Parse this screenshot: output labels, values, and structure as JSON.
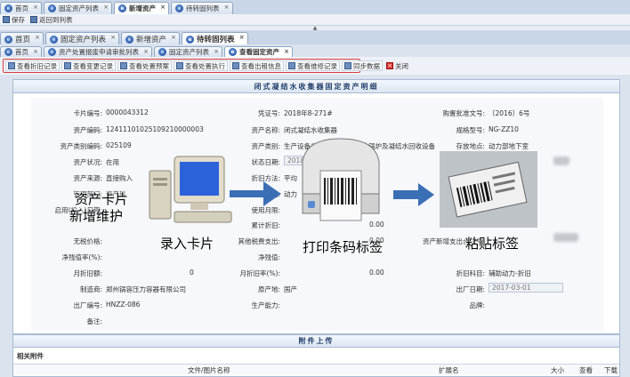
{
  "top_tabs": [
    {
      "label": "首页"
    },
    {
      "label": "固定资产列表"
    },
    {
      "label": "新增资产",
      "active": true
    },
    {
      "label": "待转固列表"
    }
  ],
  "toolbar1": {
    "save": "保存",
    "back": "返回到列表"
  },
  "second_tabs": [
    {
      "label": "首页"
    },
    {
      "label": "固定资产列表"
    },
    {
      "label": "新增资产"
    },
    {
      "label": "待转固列表",
      "active": true
    }
  ],
  "third_tabs": [
    {
      "label": "首页"
    },
    {
      "label": "资产处置报废申请审批列表"
    },
    {
      "label": "固定资产列表"
    },
    {
      "label": "查看固定资产",
      "active": true
    }
  ],
  "actions": [
    {
      "label": "查看折旧记录"
    },
    {
      "label": "查看变更记录"
    },
    {
      "label": "查看处置预案"
    },
    {
      "label": "查看处置执行"
    },
    {
      "label": "查看出租信息"
    },
    {
      "label": "查看维修记录"
    },
    {
      "label": "同步数据"
    },
    {
      "label": "关闭"
    }
  ],
  "panel_title": "闭式凝结水收集器固定资产明细",
  "fields": {
    "card_no_label": "卡片编号:",
    "card_no": "0000043312",
    "voucher_label": "凭证号:",
    "voucher": "2018年8-271#",
    "approval_label": "购置批准文号:",
    "approval": "〔2016〕6号",
    "asset_code_label": "资产编码:",
    "asset_code": "12411101025109210000003",
    "asset_name_label": "资产名称:",
    "asset_name": "闭式凝结水收集器",
    "model_label": "规格型号:",
    "model": "NG-ZZ10",
    "category_label": "资产类别编码:",
    "category": "025109",
    "category_name_label": "资产类别:",
    "category_name": "生产设备/锅炉及原动机/其他锅炉及凝结水回收设备",
    "location_label": "存放地点:",
    "location": "动力部地下室",
    "status_label": "资产状况:",
    "status": "在用",
    "status_date_label": "状态日期:",
    "status_date": "2018-08-3",
    "source_label": "资产来源:",
    "source": "直接购入",
    "depr_method_label": "折旧方法:",
    "depr_method": "平均",
    "mgmt_label": "管理部门:",
    "mgmt": "资产科",
    "use_dept_label": "使用部门:",
    "use_dept": "动力",
    "start_label": "启用(投入)日期:",
    "user_label": "使用月限:",
    "accum_label": "累计折旧:",
    "accum": "0.00",
    "intangible_label": "无税价格:",
    "other_tax_label": "其他税费支出:",
    "other_tax": "0.00",
    "new_contract_label": "资产新增支出合同号:",
    "net_rate_label": "净残值率(%):",
    "net_value_label": "净残值:",
    "monthly_label": "月折旧额:",
    "monthly": "0",
    "monthly_rate_label": "月折旧率(%):",
    "monthly_rate": "0.00",
    "depr_cat_label": "折旧科目:",
    "depr_cat": "辅助动力-折旧",
    "maker_label": "制造商:",
    "maker": "郑州锅容压力容器有限公司",
    "origin_label": "原产地:",
    "origin": "国产",
    "factory_date_label": "出厂日期:",
    "factory_date": "2017-03-01",
    "serial_label": "出厂编号:",
    "serial": "HNZZ-086",
    "capacity_label": "生产能力:",
    "brand_label": "品牌:",
    "note_label": "备注:"
  },
  "overlay": {
    "step1_line1": "资产卡片",
    "step1_line2": "新增维护",
    "step2": "录入卡片",
    "step3": "打印条码标签",
    "step4": "粘贴标签"
  },
  "attach": {
    "title": "附件上传",
    "sub": "相关附件",
    "col_name": "文件/图片名称",
    "col_ext": "扩展名",
    "col_size": "大小",
    "col_view": "查看",
    "col_download": "下载"
  },
  "colors": {
    "accent_red": "#d83c3c",
    "title_blue": "#23406b",
    "arrow_blue": "#3a6fb6"
  }
}
